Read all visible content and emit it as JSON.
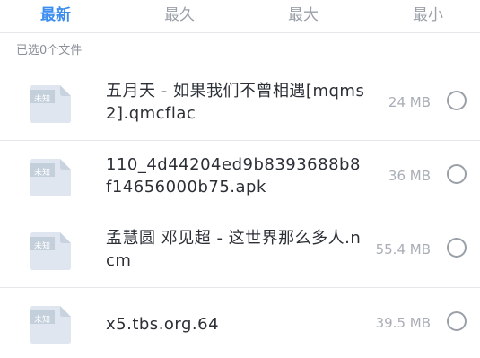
{
  "tabs": [
    {
      "label": "最新",
      "active": true
    },
    {
      "label": "最久",
      "active": false
    },
    {
      "label": "最大",
      "active": false
    },
    {
      "label": "最小",
      "active": false
    }
  ],
  "status": {
    "selected_text": "已选0个文件"
  },
  "files": [
    {
      "icon_label": "未知",
      "name": "五月天 - 如果我们不曾相遇[mqms2].qmcflac",
      "size": "24 MB",
      "icon": "unknown-file-icon"
    },
    {
      "icon_label": "未知",
      "name": "110_4d44204ed9b8393688b8f14656000b75.apk",
      "size": "36 MB",
      "icon": "unknown-file-icon"
    },
    {
      "icon_label": "未知",
      "name": "孟慧圆 邓见超 - 这世界那么多人.ncm",
      "size": "55.4 MB",
      "icon": "unknown-file-icon"
    },
    {
      "icon_label": "未知",
      "name": "x5.tbs.org.64",
      "size": "39.5 MB",
      "icon": "unknown-file-icon"
    }
  ],
  "colors": {
    "accent": "#3b8ef0",
    "icon_fill": "#dfe6ef",
    "icon_fold": "#c9d3df",
    "text_primary": "#2b2f36",
    "text_secondary": "#a9aeb6"
  }
}
